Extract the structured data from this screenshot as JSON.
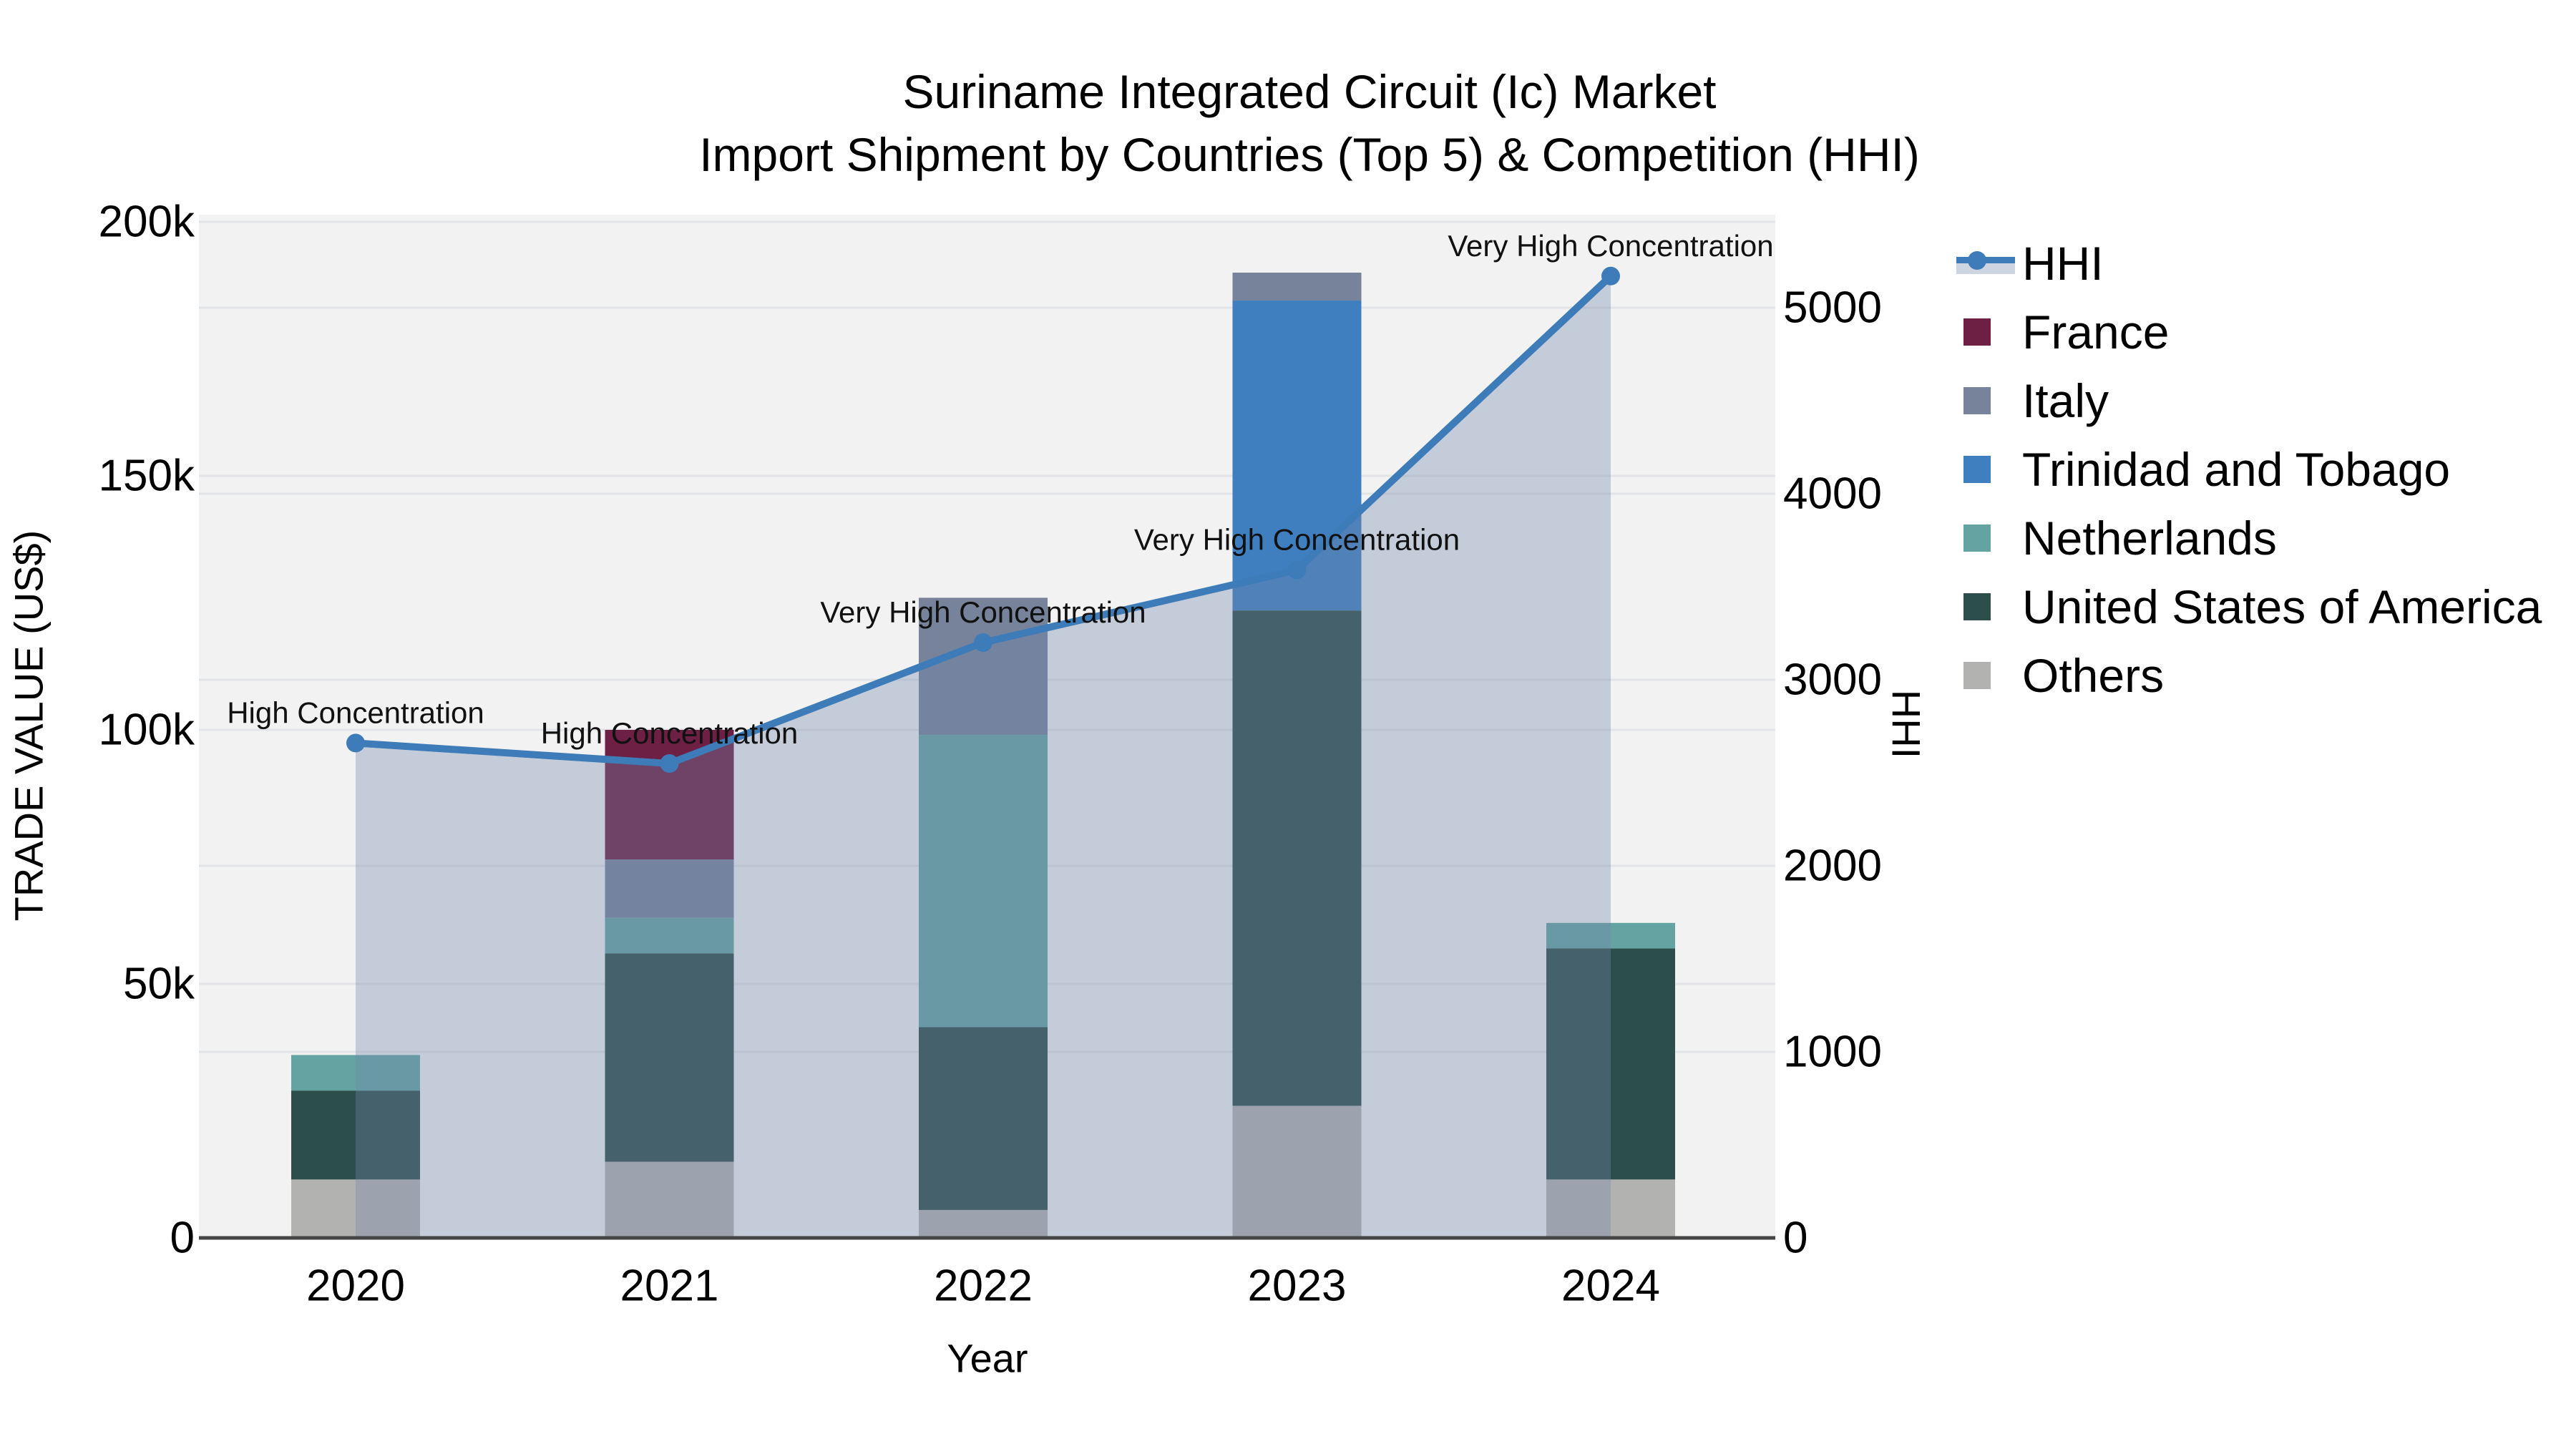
{
  "title": {
    "line1": "Suriname Integrated Circuit (Ic) Market",
    "line2": "Import Shipment by Countries (Top 5) & Competition (HHI)"
  },
  "axis_titles": {
    "x": "Year",
    "y_left": "TRADE VALUE (US$)",
    "y_right": "HHI"
  },
  "chart_data": {
    "type": [
      "stacked-bar",
      "line"
    ],
    "categories": [
      "2020",
      "2021",
      "2022",
      "2023",
      "2024"
    ],
    "y_left_axis": {
      "title": "TRADE VALUE (US$)",
      "range": [
        0,
        200000
      ],
      "ticks": [
        {
          "label": "0",
          "value": 0
        },
        {
          "label": "50k",
          "value": 50000
        },
        {
          "label": "100k",
          "value": 100000
        },
        {
          "label": "150k",
          "value": 150000
        },
        {
          "label": "200k",
          "value": 200000
        }
      ]
    },
    "y_right_axis": {
      "title": "HHI",
      "range": [
        0,
        5000
      ],
      "ticks": [
        {
          "label": "0",
          "value": 0
        },
        {
          "label": "1000",
          "value": 1000
        },
        {
          "label": "2000",
          "value": 2000
        },
        {
          "label": "3000",
          "value": 3000
        },
        {
          "label": "4000",
          "value": 4000
        },
        {
          "label": "5000",
          "value": 5000
        }
      ]
    },
    "bar_series": [
      {
        "name": "France",
        "color": "#6d2043",
        "values": [
          0,
          25500,
          0,
          0,
          0
        ]
      },
      {
        "name": "Italy",
        "color": "#76839a",
        "values": [
          0,
          11500,
          27000,
          5500,
          0
        ]
      },
      {
        "name": "Trinidad and Tobago",
        "color": "#3f7fc0",
        "values": [
          0,
          0,
          0,
          61000,
          0
        ]
      },
      {
        "name": "Netherlands",
        "color": "#63a3a1",
        "values": [
          7000,
          7000,
          57500,
          0,
          5000
        ]
      },
      {
        "name": "United States of America",
        "color": "#2d4f4b",
        "values": [
          17500,
          41000,
          36000,
          97500,
          45500
        ]
      },
      {
        "name": "Others",
        "color": "#b2b3b1",
        "values": [
          11500,
          15000,
          5500,
          26000,
          11500
        ]
      }
    ],
    "stack_order_bottom_to_top": [
      "Others",
      "United States of America",
      "Netherlands",
      "Trinidad and Tobago",
      "Italy",
      "France"
    ],
    "line_series": {
      "name": "HHI",
      "color": "#3d7cb8",
      "area_fill": "rgba(114,134,171,0.35)",
      "marker": "circle",
      "values": [
        2660,
        2550,
        3200,
        3590,
        5170
      ]
    },
    "annotations": [
      {
        "category": "2020",
        "text": "High Concentration"
      },
      {
        "category": "2021",
        "text": "High Concentration"
      },
      {
        "category": "2022",
        "text": "Very High Concentration"
      },
      {
        "category": "2023",
        "text": "Very High Concentration"
      },
      {
        "category": "2024",
        "text": "Very High Concentration"
      }
    ],
    "legend": {
      "items": [
        {
          "label": "HHI",
          "type": "line"
        },
        {
          "label": "France",
          "type": "swatch"
        },
        {
          "label": "Italy",
          "type": "swatch"
        },
        {
          "label": "Trinidad and Tobago",
          "type": "swatch"
        },
        {
          "label": "Netherlands",
          "type": "swatch"
        },
        {
          "label": "United States of America",
          "type": "swatch"
        },
        {
          "label": "Others",
          "type": "swatch"
        }
      ],
      "position": "right"
    },
    "grid": true
  },
  "style_colors": {
    "plot_bg": "#f2f2f2",
    "gridline": "#e2e4e7",
    "axis_line": "#444444",
    "text": "#000000"
  }
}
